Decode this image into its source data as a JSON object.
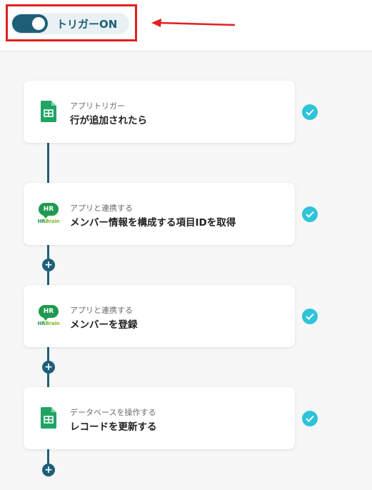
{
  "header": {
    "trigger_toggle": {
      "label": "トリガーON",
      "state": "on"
    },
    "accent_color": "#1e5f78",
    "highlight_color": "#e0201f"
  },
  "flow": {
    "steps": [
      {
        "subtitle": "アプリトリガー",
        "title": "行が追加されたら",
        "app_icon": "google-sheets-icon",
        "status": "complete"
      },
      {
        "subtitle": "アプリと連携する",
        "title": "メンバー情報を構成する項目IDを取得",
        "app_icon": "hrbrain-logo",
        "status": "complete"
      },
      {
        "subtitle": "アプリと連携する",
        "title": "メンバーを登録",
        "app_icon": "hrbrain-logo",
        "status": "complete"
      },
      {
        "subtitle": "データベースを操作する",
        "title": "レコードを更新する",
        "app_icon": "google-sheets-icon",
        "status": "complete"
      }
    ],
    "add_step_icon": "plus-icon",
    "status_color": "#2ec4d9"
  },
  "hrbrain_logo": {
    "bubble_text": "HR",
    "wordmark_hr": "HR",
    "wordmark_brain": "Brain"
  }
}
